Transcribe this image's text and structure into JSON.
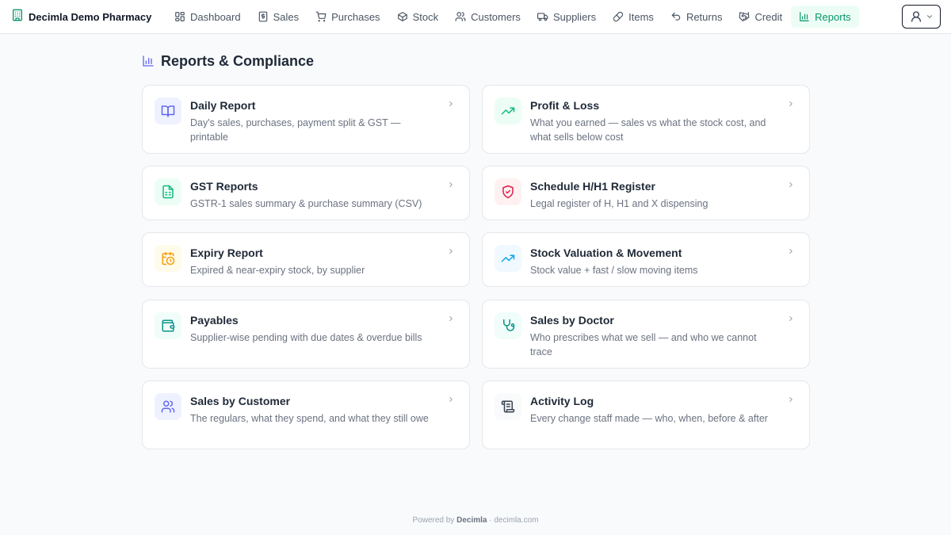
{
  "app": {
    "name": "Decimla Demo Pharmacy",
    "brand_icon": "building-icon"
  },
  "nav": [
    {
      "label": "Dashboard",
      "icon": "dashboard-icon",
      "active": false
    },
    {
      "label": "Sales",
      "icon": "receipt-icon",
      "active": false
    },
    {
      "label": "Purchases",
      "icon": "cart-icon",
      "active": false
    },
    {
      "label": "Stock",
      "icon": "box-icon",
      "active": false
    },
    {
      "label": "Customers",
      "icon": "users-icon",
      "active": false
    },
    {
      "label": "Suppliers",
      "icon": "truck-icon",
      "active": false
    },
    {
      "label": "Items",
      "icon": "pill-icon",
      "active": false
    },
    {
      "label": "Returns",
      "icon": "undo-icon",
      "active": false
    },
    {
      "label": "Credit",
      "icon": "handshake-icon",
      "active": false
    },
    {
      "label": "Reports",
      "icon": "bar-chart-icon",
      "active": true
    }
  ],
  "user_menu": {
    "icon": "user-icon",
    "caret": "chevron-down-icon"
  },
  "page": {
    "title": "Reports & Compliance",
    "title_icon": "bar-chart-icon"
  },
  "reports": [
    {
      "title": "Daily Report",
      "description": "Day's sales, purchases, payment split & GST — printable",
      "icon": "book-open-icon",
      "icon_color": "#6366f1",
      "icon_bg": "#eef2ff"
    },
    {
      "title": "Profit & Loss",
      "description": "What you earned — sales vs what the stock cost, and what sells below cost",
      "icon": "trending-up-icon",
      "icon_color": "#10b981",
      "icon_bg": "#ecfdf5"
    },
    {
      "title": "GST Reports",
      "description": "GSTR-1 sales summary & purchase summary (CSV)",
      "icon": "spreadsheet-icon",
      "icon_color": "#10b981",
      "icon_bg": "#ecfdf5"
    },
    {
      "title": "Schedule H/H1 Register",
      "description": "Legal register of H, H1 and X dispensing",
      "icon": "shield-icon",
      "icon_color": "#e11d48",
      "icon_bg": "#fff1f2"
    },
    {
      "title": "Expiry Report",
      "description": "Expired & near-expiry stock, by supplier",
      "icon": "calendar-clock-icon",
      "icon_color": "#f59e0b",
      "icon_bg": "#fffbeb"
    },
    {
      "title": "Stock Valuation & Movement",
      "description": "Stock value + fast / slow moving items",
      "icon": "trending-up-icon",
      "icon_color": "#0ea5e9",
      "icon_bg": "#f0f9ff"
    },
    {
      "title": "Payables",
      "description": "Supplier-wise pending with due dates & overdue bills",
      "icon": "wallet-icon",
      "icon_color": "#0d9488",
      "icon_bg": "#f0fdfa"
    },
    {
      "title": "Sales by Doctor",
      "description": "Who prescribes what we sell — and who we cannot trace",
      "icon": "stethoscope-icon",
      "icon_color": "#0d9488",
      "icon_bg": "#f0fdfa"
    },
    {
      "title": "Sales by Customer",
      "description": "The regulars, what they spend, and what they still owe",
      "icon": "users-icon",
      "icon_color": "#6366f1",
      "icon_bg": "#eef2ff"
    },
    {
      "title": "Activity Log",
      "description": "Every change staff made — who, when, before & after",
      "icon": "scroll-icon",
      "icon_color": "#374151",
      "icon_bg": "#f9fafb"
    }
  ],
  "footer": {
    "prefix": "Powered by",
    "brand": "Decimla",
    "suffix": "· decimla.com"
  }
}
